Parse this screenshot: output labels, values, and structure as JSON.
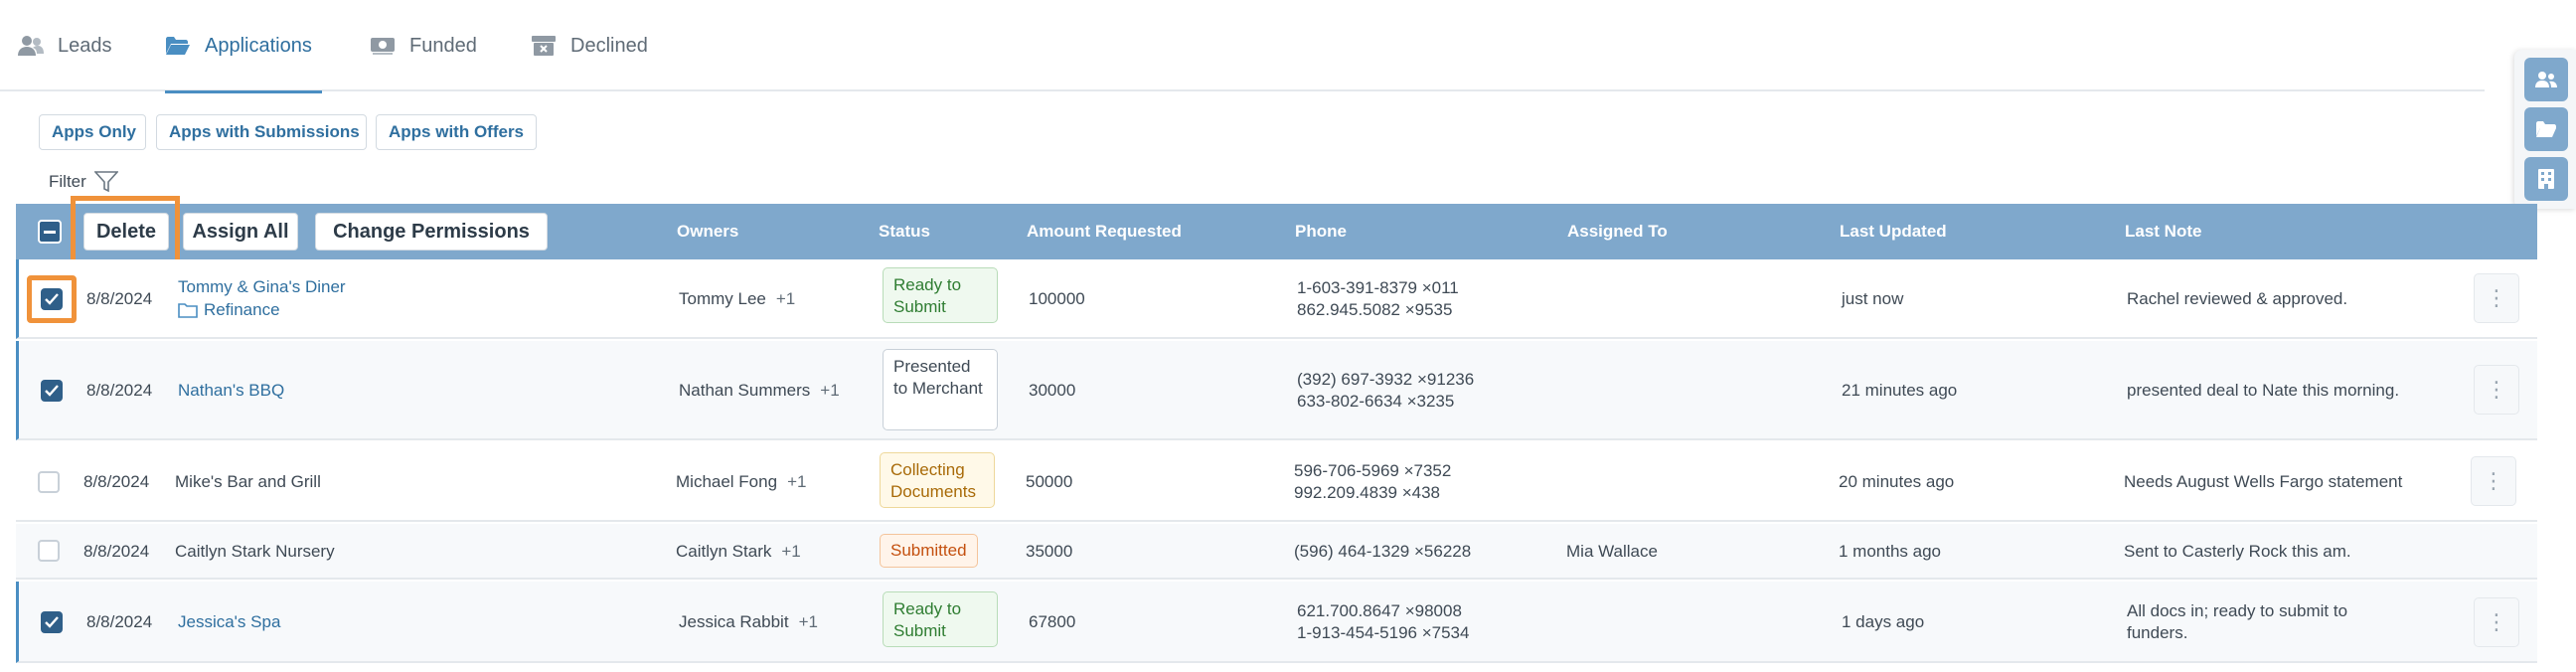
{
  "tabs": [
    {
      "label": "Leads",
      "icon": "users-icon",
      "active": false
    },
    {
      "label": "Applications",
      "icon": "folder-open-icon",
      "active": true
    },
    {
      "label": "Funded",
      "icon": "money-icon",
      "active": false
    },
    {
      "label": "Declined",
      "icon": "archive-box-icon",
      "active": false
    }
  ],
  "quick_filters": [
    "Apps Only",
    "Apps with Submissions",
    "Apps with Offers"
  ],
  "filter_label": "Filter",
  "bulk_actions": {
    "delete": "Delete",
    "assign_all": "Assign All",
    "change_permissions": "Change Permissions"
  },
  "columns": {
    "owners": "Owners",
    "status": "Status",
    "amount": "Amount Requested",
    "phone": "Phone",
    "assigned": "Assigned To",
    "updated": "Last Updated",
    "note": "Last Note"
  },
  "rows": [
    {
      "checked": true,
      "date": "8/8/2024",
      "name": "Tommy & Gina's Diner",
      "sub": "Refinance",
      "owner": "Tommy Lee",
      "owner_extra": "+1",
      "status": "Ready to Submit",
      "amount": "100000",
      "phone1": "1-603-391-8379 ×011",
      "phone2": "862.945.5082 ×9535",
      "assigned": "",
      "updated": "just now",
      "note": "Rachel reviewed & approved."
    },
    {
      "checked": true,
      "date": "8/8/2024",
      "name": "Nathan's BBQ",
      "owner": "Nathan Summers",
      "owner_extra": "+1",
      "status": "Presented to Merchant",
      "amount": "30000",
      "phone1": "(392) 697-3932 ×91236",
      "phone2": "633-802-6634 ×3235",
      "assigned": "",
      "updated": "21 minutes ago",
      "note": "presented deal to Nate this morning."
    },
    {
      "checked": false,
      "date": "8/8/2024",
      "name": "Mike's Bar and Grill",
      "owner": "Michael Fong",
      "owner_extra": "+1",
      "status": "Collecting Documents",
      "amount": "50000",
      "phone1": "596-706-5969 ×7352",
      "phone2": "992.209.4839 ×438",
      "assigned": "",
      "updated": "20 minutes ago",
      "note": "Needs August Wells Fargo statement"
    },
    {
      "checked": false,
      "date": "8/8/2024",
      "name": "Caitlyn Stark Nursery",
      "owner": "Caitlyn Stark",
      "owner_extra": "+1",
      "status": "Submitted",
      "amount": "35000",
      "phone1": "(596) 464-1329 ×56228",
      "assigned": "Mia Wallace",
      "updated": "1 months ago",
      "note": "Sent to Casterly Rock this am."
    },
    {
      "checked": true,
      "date": "8/8/2024",
      "name": "Jessica's Spa",
      "owner": "Jessica Rabbit",
      "owner_extra": "+1",
      "status": "Ready to Submit",
      "amount": "67800",
      "phone1": "621.700.8647 ×98008",
      "phone2": "1-913-454-5196 ×7534",
      "assigned": "",
      "updated": "1 days ago",
      "note_line1": "All docs in; ready to submit to",
      "note_line2": "funders."
    }
  ],
  "side_buttons": [
    "contacts-icon",
    "folder-icon",
    "building-icon"
  ],
  "colors": {
    "header": "#7fa8cc",
    "link": "#2f6f9f",
    "highlight": "#f0923a",
    "checkbox": "#2f5f89"
  }
}
